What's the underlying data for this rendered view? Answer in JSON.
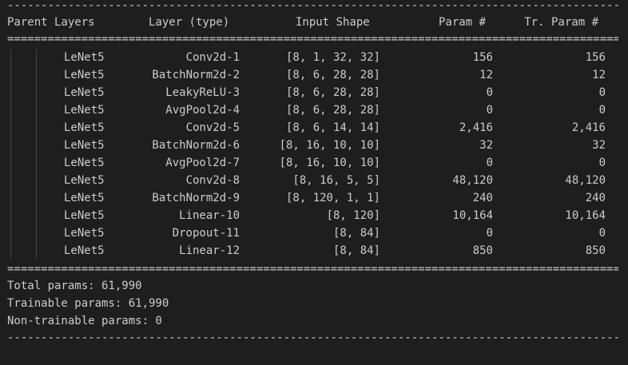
{
  "headers": {
    "parent": "Parent Layers",
    "layer": "Layer (type)",
    "input": "Input Shape",
    "param": "Param #",
    "tr_param": "Tr. Param #"
  },
  "rows": [
    {
      "parent": "LeNet5",
      "layer": "Conv2d-1",
      "input": "[8, 1, 32, 32]",
      "param": "156",
      "tr": "156"
    },
    {
      "parent": "LeNet5",
      "layer": "BatchNorm2d-2",
      "input": "[8, 6, 28, 28]",
      "param": "12",
      "tr": "12"
    },
    {
      "parent": "LeNet5",
      "layer": "LeakyReLU-3",
      "input": "[8, 6, 28, 28]",
      "param": "0",
      "tr": "0"
    },
    {
      "parent": "LeNet5",
      "layer": "AvgPool2d-4",
      "input": "[8, 6, 28, 28]",
      "param": "0",
      "tr": "0"
    },
    {
      "parent": "LeNet5",
      "layer": "Conv2d-5",
      "input": "[8, 6, 14, 14]",
      "param": "2,416",
      "tr": "2,416"
    },
    {
      "parent": "LeNet5",
      "layer": "BatchNorm2d-6",
      "input": "[8, 16, 10, 10]",
      "param": "32",
      "tr": "32"
    },
    {
      "parent": "LeNet5",
      "layer": "AvgPool2d-7",
      "input": "[8, 16, 10, 10]",
      "param": "0",
      "tr": "0"
    },
    {
      "parent": "LeNet5",
      "layer": "Conv2d-8",
      "input": "[8, 16, 5, 5]",
      "param": "48,120",
      "tr": "48,120"
    },
    {
      "parent": "LeNet5",
      "layer": "BatchNorm2d-9",
      "input": "[8, 120, 1, 1]",
      "param": "240",
      "tr": "240"
    },
    {
      "parent": "LeNet5",
      "layer": "Linear-10",
      "input": "[8, 120]",
      "param": "10,164",
      "tr": "10,164"
    },
    {
      "parent": "LeNet5",
      "layer": "Dropout-11",
      "input": "[8, 84]",
      "param": "0",
      "tr": "0"
    },
    {
      "parent": "LeNet5",
      "layer": "Linear-12",
      "input": "[8, 84]",
      "param": "850",
      "tr": "850"
    }
  ],
  "summary": {
    "total": "Total params: 61,990",
    "trainable": "Trainable params: 61,990",
    "non_trainable": "Non-trainable params: 0"
  },
  "colors": {
    "background": "#1e1e1e",
    "text": "#cccccc"
  }
}
